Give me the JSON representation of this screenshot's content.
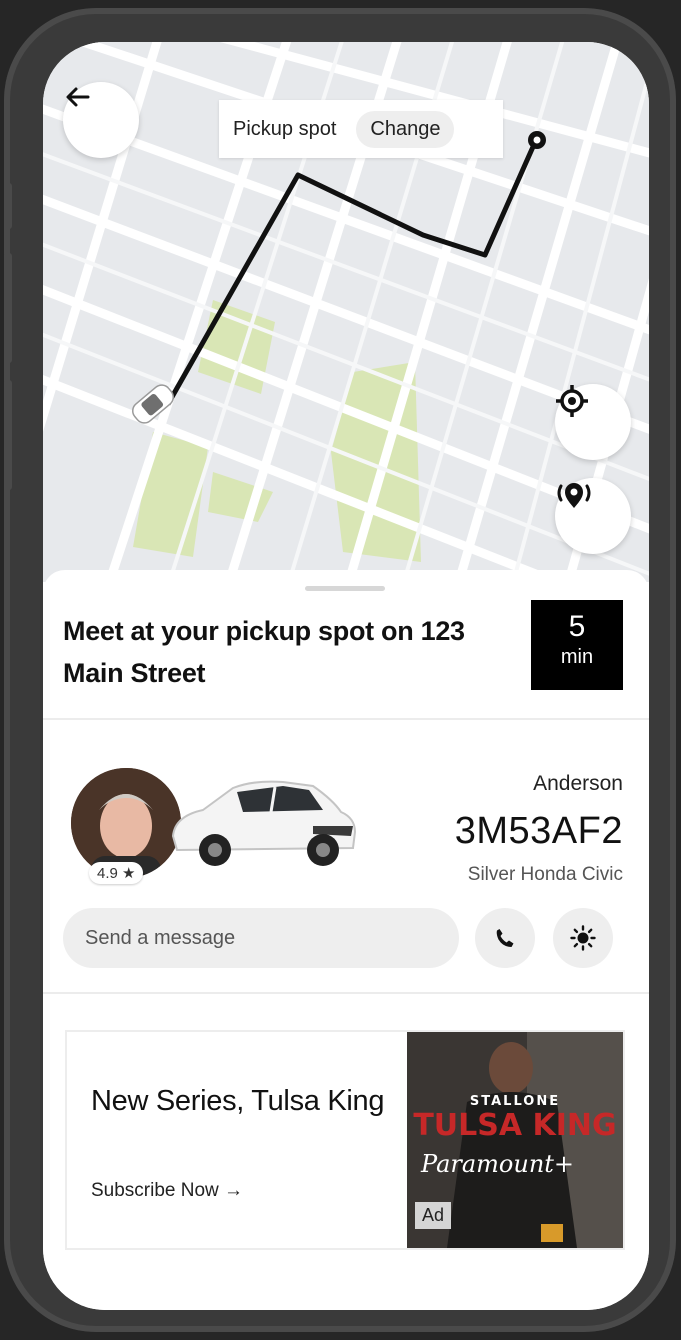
{
  "map": {
    "pickup_label": "Pickup spot",
    "change_label": "Change",
    "back_icon": "arrow-left-icon",
    "locate_icon": "crosshair-icon",
    "poi_icon": "location-pin-broadcast-icon"
  },
  "trip": {
    "meet_text": "Meet at your pickup spot on 123 Main Street",
    "eta_value": "5",
    "eta_unit": "min"
  },
  "driver": {
    "name": "Anderson",
    "plate": "3M53AF2",
    "car": "Silver Honda Civic",
    "rating": "4.9 ★"
  },
  "actions": {
    "message_placeholder": "Send a message",
    "call_icon": "phone-icon",
    "safety_icon": "shield-sun-icon"
  },
  "ad": {
    "title": "New Series, Tulsa King",
    "cta": "Subscribe Now →",
    "badge": "Ad",
    "image_text_top": "STALLONE",
    "image_text_show": "TULSA KING",
    "image_text_brand": "Paramount+"
  },
  "colors": {
    "map_bg": "#e7e9ec",
    "park": "#d9e6b5",
    "route": "#111111",
    "eta_bg": "#000000"
  }
}
